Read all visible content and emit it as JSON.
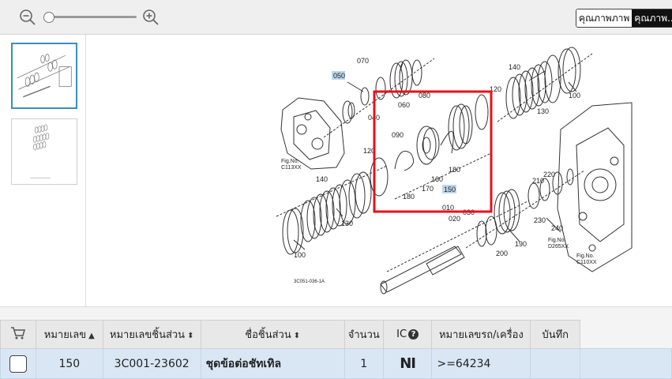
{
  "toolbar": {
    "zoom_out_icon": "zoom-out-icon",
    "zoom_in_icon": "zoom-in-icon",
    "zoom_level": 0,
    "quality_normal_label": "คุณภาพภาพ",
    "quality_high_label": "คุณภาพ..."
  },
  "thumbnails": [
    {
      "name": "thumbnail-1",
      "active": true
    },
    {
      "name": "thumbnail-2",
      "active": false
    }
  ],
  "diagram": {
    "labels": [
      "050",
      "070",
      "060",
      "080",
      "040",
      "140",
      "120",
      "100",
      "090",
      "160",
      "170",
      "180",
      "180",
      "150",
      "120",
      "130",
      "140",
      "130",
      "100",
      "010",
      "020",
      "030",
      "190",
      "200",
      "210",
      "220",
      "230",
      "240"
    ],
    "fig_labels": [
      "Fig.No.\nC113XX",
      "Fig.No.\nD265XX",
      "Fig.No.\nC110XX"
    ],
    "drawing_code": "3C051-036-1A",
    "highlighted_label": "150",
    "highlight_color": "#e8101a",
    "label_highlight_color": "#bcd6ef"
  },
  "table": {
    "headers": {
      "cart_icon": "cart-icon",
      "ref_no": "หมายเลข",
      "part_no": "หมายเลขชิ้นส่วน",
      "part_name": "ชื่อชิ้นส่วน",
      "qty": "จำนวน",
      "ic": "IC",
      "serial": "หมายเลขรถ/เครื่อง",
      "note": "บันทึก"
    },
    "rows": [
      {
        "ref_no": "150",
        "part_no": "3C001-23602",
        "part_name": "ชุดข้อต่อชัทเทิล",
        "qty": "1",
        "ic": "NI",
        "serial": ">=64234",
        "note": ""
      }
    ]
  }
}
